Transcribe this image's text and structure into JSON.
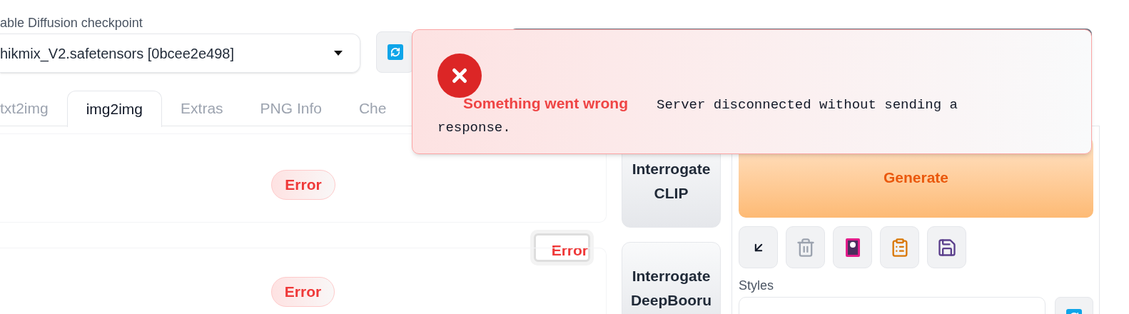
{
  "checkpoint": {
    "label": "able Diffusion checkpoint",
    "value": "hikmix_V2.safetensors [0bcee2e498]"
  },
  "tabs": [
    {
      "label": "txt2img",
      "selected": false
    },
    {
      "label": "img2img",
      "selected": true
    },
    {
      "label": "Extras",
      "selected": false
    },
    {
      "label": "PNG Info",
      "selected": false
    },
    {
      "label": "Che",
      "selected": false
    }
  ],
  "error_badges": [
    {
      "kind": "pill",
      "text": "Error"
    },
    {
      "kind": "box",
      "text": "Error"
    },
    {
      "kind": "pill",
      "text": "Error"
    }
  ],
  "interrogate_buttons": [
    "Interrogate CLIP",
    "Interrogate DeepBooru"
  ],
  "generate_button": "Generate",
  "styles": {
    "label": "Styles"
  },
  "toast": {
    "title": "Something went wrong",
    "message": "Server disconnected without sending a response."
  }
}
